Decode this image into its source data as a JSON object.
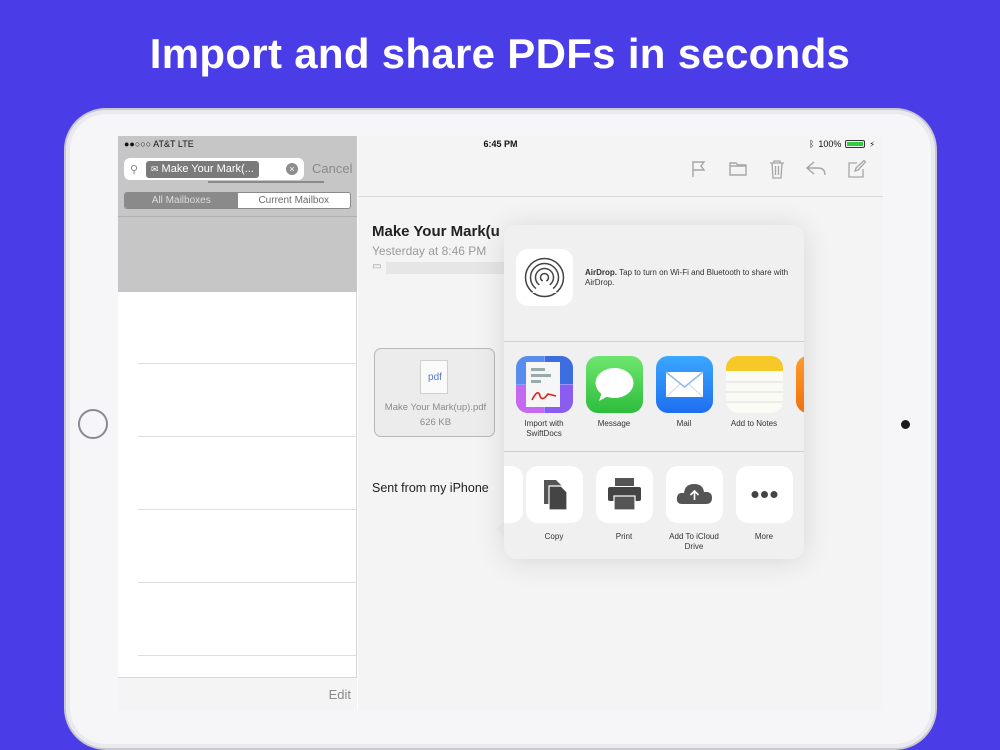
{
  "headline": "Import and share PDFs in seconds",
  "status_bar": {
    "carrier": "●●○○○ AT&T  LTE",
    "time": "6:45 PM",
    "battery": "100%"
  },
  "search": {
    "token": "Make Your Mark(...",
    "cancel_label": "Cancel"
  },
  "scope": {
    "all_mailboxes": "All Mailboxes",
    "current_mailbox": "Current Mailbox"
  },
  "left_footer": {
    "edit_label": "Edit"
  },
  "message": {
    "subject": "Make Your Mark(u",
    "date": "Yesterday at 8:46 PM",
    "body": "Sent from my iPhone"
  },
  "attachment": {
    "type_label": "pdf",
    "filename": "Make Your Mark(up).pdf",
    "size": "626 KB"
  },
  "share_sheet": {
    "airdrop_title": "AirDrop.",
    "airdrop_text": " Tap to turn on Wi-Fi and Bluetooth to share with AirDrop.",
    "apps": [
      {
        "label": "Import with SwiftDocs",
        "icon": "swiftdocs-icon"
      },
      {
        "label": "Message",
        "icon": "message-icon"
      },
      {
        "label": "Mail",
        "icon": "mail-icon"
      },
      {
        "label": "Add to Notes",
        "icon": "notes-icon"
      }
    ],
    "actions": [
      {
        "label": "Copy",
        "icon": "copy-icon"
      },
      {
        "label": "Print",
        "icon": "print-icon"
      },
      {
        "label": "Add To iCloud Drive",
        "icon": "icloud-drive-icon"
      },
      {
        "label": "More",
        "icon": "more-icon"
      }
    ]
  },
  "colors": {
    "background": "#4a3de8",
    "message_green": "#3cc94a",
    "mail_blue": "#1e7cf0",
    "notes_yellow": "#f8d030"
  }
}
